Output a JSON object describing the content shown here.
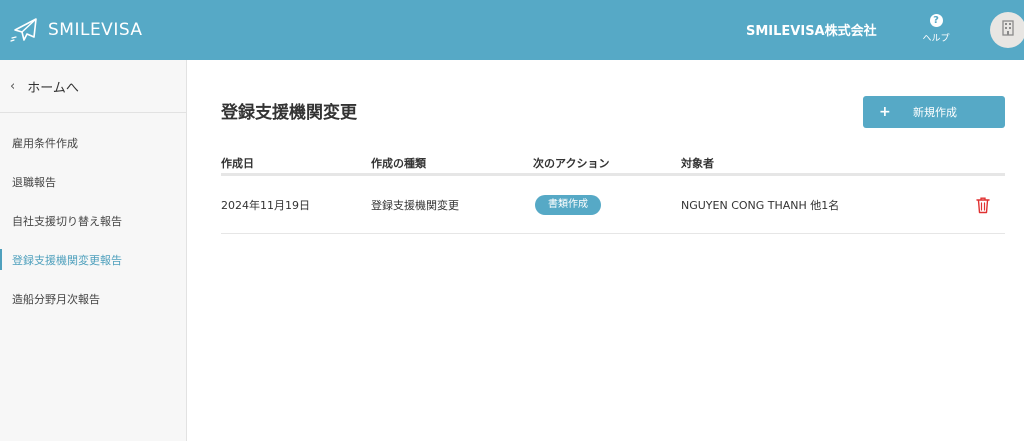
{
  "header": {
    "brand": "SMILEVISA",
    "company": "SMILEVISA株式会社",
    "help_label": "ヘルプ",
    "help_icon": "help-circle-icon",
    "avatar_icon": "building-icon",
    "color": "#56a9c6"
  },
  "sidebar": {
    "home_label": "ホームへ",
    "items": [
      {
        "label": "雇用条件作成",
        "active": false
      },
      {
        "label": "退職報告",
        "active": false
      },
      {
        "label": "自社支援切り替え報告",
        "active": false
      },
      {
        "label": "登録支援機関変更報告",
        "active": true
      },
      {
        "label": "造船分野月次報告",
        "active": false
      }
    ],
    "active_color": "#4fa0bd"
  },
  "main": {
    "title": "登録支援機関変更",
    "new_button_label": "新規作成",
    "columns": [
      "作成日",
      "作成の種類",
      "次のアクション",
      "対象者"
    ],
    "rows": [
      {
        "date": "2024年11月19日",
        "type": "登録支援機関変更",
        "action": "書類作成",
        "target": "NGUYEN CONG THANH 他1名",
        "delete_icon": "trash-icon",
        "delete_color": "#e03131"
      }
    ]
  }
}
